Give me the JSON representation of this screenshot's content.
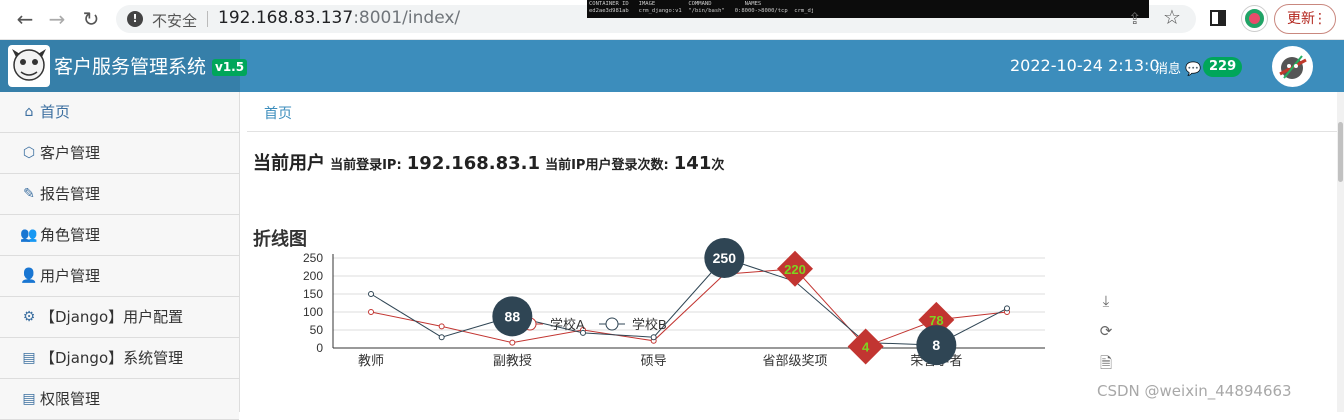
{
  "browser": {
    "back_label": "←",
    "forward_label": "→",
    "reload_label": "↻",
    "insecure_label": "不安全",
    "url_host": "192.168.83.137",
    "url_rest": ":8001/index/",
    "update_label": "更新",
    "terminal": {
      "header": "CONTAINER ID   IMAGE          COMMAND          NAMES",
      "row": "ed2ae3d981ab   crm_django:v1  \"/bin/bash\"   0:8000->8000/tcp  crm_dj"
    }
  },
  "header": {
    "title": "客户服务管理系统",
    "version": "v1.5",
    "datetime": "2022-10-24 2:13:0",
    "messages_label": "消息",
    "messages_count": "229"
  },
  "sidebar": {
    "items": [
      {
        "label": "首页",
        "icon": "home-icon"
      },
      {
        "label": "客户管理",
        "icon": "hexagon-icon"
      },
      {
        "label": "报告管理",
        "icon": "edit-icon"
      },
      {
        "label": "角色管理",
        "icon": "users-icon"
      },
      {
        "label": "用户管理",
        "icon": "user-plus-icon"
      },
      {
        "label": "【Django】用户配置",
        "icon": "gear-icon"
      },
      {
        "label": "【Django】系统管理",
        "icon": "id-card-icon"
      },
      {
        "label": "权限管理",
        "icon": "id-card-icon"
      }
    ]
  },
  "breadcrumb": {
    "home": "首页"
  },
  "user_info": {
    "heading": "当前用户",
    "ip_label": "当前登录IP:",
    "ip_value": "192.168.83.1",
    "count_label": "当前IP用户登录次数:",
    "count_value": "141",
    "count_unit": "次"
  },
  "line_chart": {
    "section_title": "折线图"
  },
  "chart_data": {
    "type": "line",
    "categories": [
      "教师",
      "",
      "副教授",
      "",
      "硕导",
      "",
      "省部级奖项",
      "",
      "荣誉学者",
      ""
    ],
    "ylim": [
      0,
      250
    ],
    "yticks": [
      0,
      50,
      100,
      150,
      200,
      250
    ],
    "series": [
      {
        "name": "学校A",
        "color": "#c23531",
        "values": [
          100,
          60,
          15,
          50,
          20,
          205,
          220,
          4,
          78,
          100
        ]
      },
      {
        "name": "学校B",
        "color": "#2f4554",
        "values": [
          150,
          30,
          88,
          42,
          30,
          250,
          185,
          15,
          8,
          110
        ]
      }
    ],
    "markers": [
      {
        "series": 1,
        "index": 2,
        "label": "88",
        "shape": "circle"
      },
      {
        "series": 1,
        "index": 5,
        "label": "250",
        "shape": "circle"
      },
      {
        "series": 0,
        "index": 6,
        "label": "220",
        "shape": "diamond"
      },
      {
        "series": 0,
        "index": 7,
        "label": "4",
        "shape": "diamond"
      },
      {
        "series": 0,
        "index": 8,
        "label": "78",
        "shape": "diamond"
      },
      {
        "series": 1,
        "index": 8,
        "label": "8",
        "shape": "circle"
      }
    ],
    "legend_position": "top",
    "grid": true
  },
  "toolbox": [
    "download-icon",
    "refresh-icon",
    "data-view-icon"
  ],
  "watermark": "CSDN @weixin_44894663"
}
